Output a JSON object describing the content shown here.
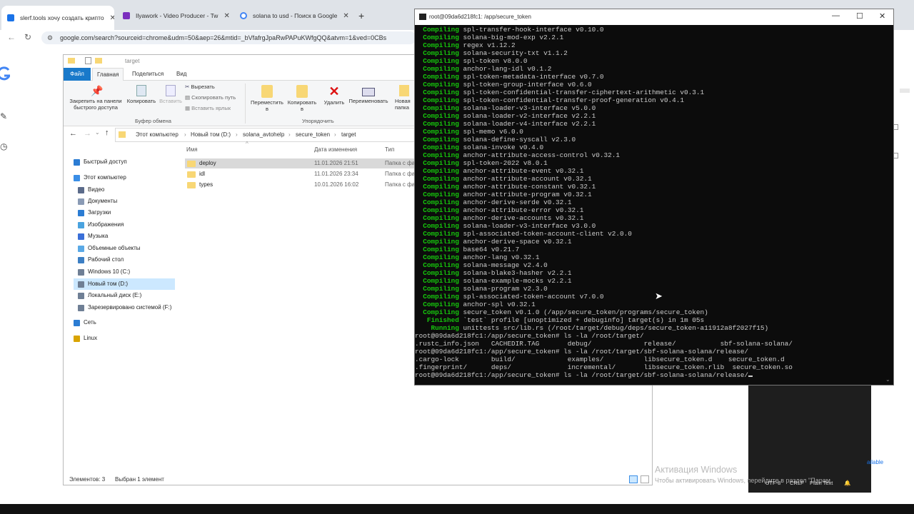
{
  "browser": {
    "tabs": [
      {
        "title": "slerf.tools хочу создать крипто",
        "color": "#1a73e8"
      },
      {
        "title": "Ilyawork - Video Producer - Tw",
        "color": "#7b2fbe"
      },
      {
        "title": "solana to usd - Поиск в Google",
        "color": "#4285f4"
      }
    ],
    "new_tab": "+",
    "url": "google.com/search?sourceid=chrome&udm=50&aep=26&mtid=_bVfafrgJpaRwPAPuKWfgQQ&atvm=1&ved=0CBs"
  },
  "explorer": {
    "title": "target",
    "ribbon_tabs": [
      "Файл",
      "Главная",
      "Поделиться",
      "Вид"
    ],
    "buttons": {
      "pin": "Закрепить на панели\nбыстрого доступа",
      "copy": "Копировать",
      "paste": "Вставить",
      "cut": "Вырезать",
      "copy_path": "Скопировать путь",
      "paste_shortcut": "Вставить ярлык",
      "move_to": "Переместить\nв",
      "copy_to": "Копировать\nв",
      "delete": "Удалить",
      "rename": "Переименовать",
      "new_folder": "Новая\nпапка"
    },
    "groups": {
      "clipboard": "Буфер обмена",
      "organize": "Упорядочить"
    },
    "breadcrumb": [
      "Этот компьютер",
      "Новый том (D:)",
      "solana_avtohelp",
      "secure_token",
      "target"
    ],
    "nav": [
      {
        "label": "Быстрый доступ",
        "color": "#2b7cd3",
        "indent": 0
      },
      {
        "label": "Этот компьютер",
        "color": "#3a8ee6",
        "indent": 0
      },
      {
        "label": "Видео",
        "color": "#5b6b8a",
        "indent": 1
      },
      {
        "label": "Документы",
        "color": "#8a9bb5",
        "indent": 1
      },
      {
        "label": "Загрузки",
        "color": "#2b7cd3",
        "indent": 1
      },
      {
        "label": "Изображения",
        "color": "#4aa3df",
        "indent": 1
      },
      {
        "label": "Музыка",
        "color": "#3a6fd8",
        "indent": 1
      },
      {
        "label": "Объемные объекты",
        "color": "#5aa9e6",
        "indent": 1
      },
      {
        "label": "Рабочий стол",
        "color": "#3c7fc4",
        "indent": 1
      },
      {
        "label": "Windows 10 (C:)",
        "color": "#6f7f95",
        "indent": 1
      },
      {
        "label": "Новый том (D:)",
        "color": "#6f7f95",
        "indent": 1,
        "selected": true
      },
      {
        "label": "Локальный диск (E:)",
        "color": "#6f7f95",
        "indent": 1
      },
      {
        "label": "Зарезервировано системой (F:)",
        "color": "#6f7f95",
        "indent": 1
      },
      {
        "label": "Сеть",
        "color": "#2b7cd3",
        "indent": 0
      },
      {
        "label": "Linux",
        "color": "#d9a400",
        "indent": 0
      }
    ],
    "columns": {
      "name": "Имя",
      "date": "Дата изменения",
      "type": "Тип"
    },
    "files": [
      {
        "name": "deploy",
        "date": "11.01.2026 21:51",
        "type": "Папка с фа",
        "selected": true
      },
      {
        "name": "idl",
        "date": "11.01.2026 23:34",
        "type": "Папка с фа"
      },
      {
        "name": "types",
        "date": "10.01.2026 16:02",
        "type": "Папка с фа"
      }
    ],
    "status": {
      "count": "Элементов: 3",
      "selected": "Выбран 1 элемент"
    }
  },
  "terminal": {
    "title": "root@09da6d218fc1: /app/secure_token",
    "lines": [
      {
        "k": "Compiling",
        "t": "spl-transfer-hook-interface v0.10.0"
      },
      {
        "k": "Compiling",
        "t": "solana-big-mod-exp v2.2.1"
      },
      {
        "k": "Compiling",
        "t": "regex v1.12.2"
      },
      {
        "k": "Compiling",
        "t": "solana-security-txt v1.1.2"
      },
      {
        "k": "Compiling",
        "t": "spl-token v8.0.0"
      },
      {
        "k": "Compiling",
        "t": "anchor-lang-idl v0.1.2"
      },
      {
        "k": "Compiling",
        "t": "spl-token-metadata-interface v0.7.0"
      },
      {
        "k": "Compiling",
        "t": "spl-token-group-interface v0.6.0"
      },
      {
        "k": "Compiling",
        "t": "spl-token-confidential-transfer-ciphertext-arithmetic v0.3.1"
      },
      {
        "k": "Compiling",
        "t": "spl-token-confidential-transfer-proof-generation v0.4.1"
      },
      {
        "k": "Compiling",
        "t": "solana-loader-v3-interface v5.0.0"
      },
      {
        "k": "Compiling",
        "t": "solana-loader-v2-interface v2.2.1"
      },
      {
        "k": "Compiling",
        "t": "solana-loader-v4-interface v2.2.1"
      },
      {
        "k": "Compiling",
        "t": "spl-memo v6.0.0"
      },
      {
        "k": "Compiling",
        "t": "solana-define-syscall v2.3.0"
      },
      {
        "k": "Compiling",
        "t": "solana-invoke v0.4.0"
      },
      {
        "k": "Compiling",
        "t": "anchor-attribute-access-control v0.32.1"
      },
      {
        "k": "Compiling",
        "t": "spl-token-2022 v8.0.1"
      },
      {
        "k": "Compiling",
        "t": "anchor-attribute-event v0.32.1"
      },
      {
        "k": "Compiling",
        "t": "anchor-attribute-account v0.32.1"
      },
      {
        "k": "Compiling",
        "t": "anchor-attribute-constant v0.32.1"
      },
      {
        "k": "Compiling",
        "t": "anchor-attribute-program v0.32.1"
      },
      {
        "k": "Compiling",
        "t": "anchor-derive-serde v0.32.1"
      },
      {
        "k": "Compiling",
        "t": "anchor-attribute-error v0.32.1"
      },
      {
        "k": "Compiling",
        "t": "anchor-derive-accounts v0.32.1"
      },
      {
        "k": "Compiling",
        "t": "solana-loader-v3-interface v3.0.0"
      },
      {
        "k": "Compiling",
        "t": "spl-associated-token-account-client v2.0.0"
      },
      {
        "k": "Compiling",
        "t": "anchor-derive-space v0.32.1"
      },
      {
        "k": "Compiling",
        "t": "base64 v0.21.7"
      },
      {
        "k": "Compiling",
        "t": "anchor-lang v0.32.1"
      },
      {
        "k": "Compiling",
        "t": "solana-message v2.4.0"
      },
      {
        "k": "Compiling",
        "t": "solana-blake3-hasher v2.2.1"
      },
      {
        "k": "Compiling",
        "t": "solana-example-mocks v2.2.1"
      },
      {
        "k": "Compiling",
        "t": "solana-program v2.3.0"
      },
      {
        "k": "Compiling",
        "t": "spl-associated-token-account v7.0.0"
      },
      {
        "k": "Compiling",
        "t": "anchor-spl v0.32.1"
      },
      {
        "k": "Compiling",
        "t": "secure_token v0.1.0 (/app/secure_token/programs/secure_token)"
      },
      {
        "k": " Finished",
        "t": "`test` profile [unoptimized + debuginfo] target(s) in 1m 05s"
      },
      {
        "k": "  Running",
        "t": "unittests src/lib.rs (/root/target/debug/deps/secure_token-a11912a8f2027f15)"
      },
      {
        "p": "root@09da6d218fc1:/app/secure_token# ls -la /root/target/"
      },
      {
        "p": ".rustc_info.json   CACHEDIR.TAG       debug/             release/           sbf-solana-solana/"
      },
      {
        "p": "root@09da6d218fc1:/app/secure_token# ls -la /root/target/sbf-solana-solana/release/"
      },
      {
        "p": ".cargo-lock        build/             examples/          libsecure_token.d    secure_token.d"
      },
      {
        "p": ".fingerprint/      deps/              incremental/       libsecure_token.rlib  secure_token.so"
      },
      {
        "p": "root@09da6d218fc1:/app/secure_token# ls -la /root/target/sbf-solana-solana/release/"
      }
    ]
  },
  "watermark": {
    "title": "Активация Windows",
    "subtitle": "Чтобы активировать Windows, перейдите в раздел \"Парам"
  },
  "editor_status": {
    "encoding": "UTF-8",
    "eol": "CRLF",
    "lang": "Plain Text",
    "avail": "ailable"
  }
}
